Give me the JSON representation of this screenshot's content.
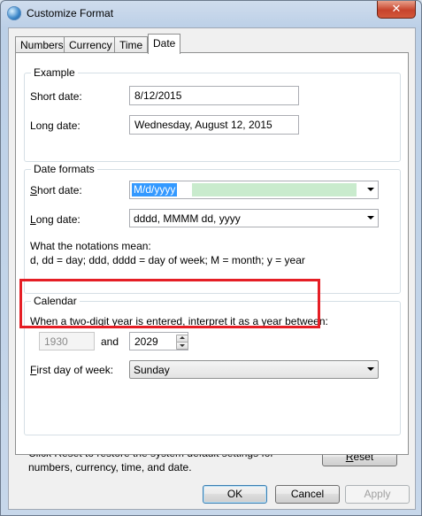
{
  "window": {
    "title": "Customize Format",
    "close_glyph": "✕"
  },
  "tabs": [
    {
      "label": "Numbers"
    },
    {
      "label": "Currency"
    },
    {
      "label": "Time"
    },
    {
      "label": "Date"
    }
  ],
  "example": {
    "title": "Example",
    "short_label": "Short date:",
    "short_value": "8/12/2015",
    "long_label": "Long date:",
    "long_value": "Wednesday, August 12, 2015"
  },
  "formats": {
    "title": "Date formats",
    "short_label_u": "S",
    "short_label_rest": "hort date:",
    "short_value": "M/d/yyyy",
    "long_label_u": "L",
    "long_label_rest": "ong date:",
    "long_value": "dddd, MMMM dd, yyyy",
    "notation_line1": "What the notations mean:",
    "notation_line2": "d, dd = day;  ddd, dddd = day of week;  M = month;  y = year"
  },
  "calendar": {
    "title": "Calendar",
    "twodigit_u": "W",
    "twodigit_rest": "hen a two-digit year is entered, interpret it as a year between:",
    "year_start": "1930",
    "and_label": "and",
    "year_end": "2029",
    "firstday_u": "F",
    "firstday_rest": "irst day of week:",
    "firstday_value": "Sunday"
  },
  "footer": {
    "reset_text_line1": "Click Reset to restore the system default settings for",
    "reset_text_line2": "numbers, currency, time, and date.",
    "reset_u": "R",
    "reset_rest": "eset"
  },
  "buttons": {
    "ok": "OK",
    "cancel": "Cancel",
    "apply": "Apply"
  },
  "colors": {
    "highlight": "#e51e25",
    "selection": "#3399ff"
  }
}
